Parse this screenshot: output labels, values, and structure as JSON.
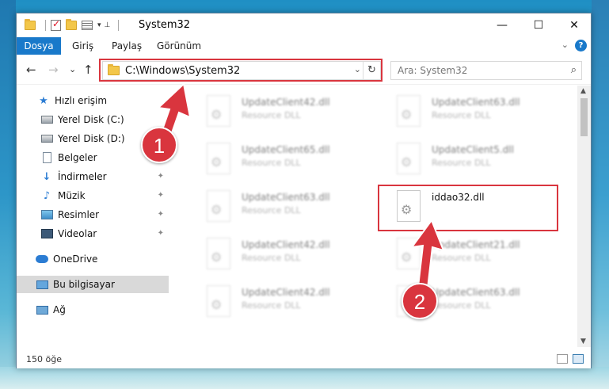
{
  "window": {
    "title": "System32",
    "minimize": "—",
    "maximize": "☐",
    "close": "✕"
  },
  "ribbon": {
    "tabs": [
      "Dosya",
      "Giriş",
      "Paylaş",
      "Görünüm"
    ],
    "expand_glyph": "⌄",
    "help_glyph": "?"
  },
  "nav": {
    "back": "←",
    "forward": "→",
    "recent": "⌄",
    "up": "↑",
    "address": "C:\\Windows\\System32",
    "dropdown": "⌄",
    "refresh": "↻",
    "search_placeholder": "Ara: System32",
    "search_icon": "⌕"
  },
  "sidebar": {
    "items": [
      {
        "label": "Hızlı erişim",
        "icon": "star-icon",
        "glyph": "★"
      },
      {
        "label": "Yerel Disk (C:)",
        "icon": "drive-icon"
      },
      {
        "label": "Yerel Disk (D:)",
        "icon": "drive-icon"
      },
      {
        "label": "Belgeler",
        "icon": "documents-icon"
      },
      {
        "label": "İndirmeler",
        "icon": "download-icon",
        "glyph": "↓"
      },
      {
        "label": "Müzik",
        "icon": "music-icon",
        "glyph": "♪"
      },
      {
        "label": "Resimler",
        "icon": "pictures-icon"
      },
      {
        "label": "Videolar",
        "icon": "videos-icon"
      },
      {
        "label": "OneDrive",
        "icon": "cloud-icon"
      },
      {
        "label": "Bu bilgisayar",
        "icon": "computer-icon"
      },
      {
        "label": "Ağ",
        "icon": "network-icon"
      }
    ],
    "pin_glyph": "📌"
  },
  "files": [
    {
      "name": "UpdateClient42.dll",
      "type": "Resource DLL"
    },
    {
      "name": "UpdateClient63.dll",
      "type": "Resource DLL"
    },
    {
      "name": "UpdateClient65.dll",
      "type": "Resource DLL"
    },
    {
      "name": "UpdateClient5.dll",
      "type": "Resource DLL"
    },
    {
      "name": "UpdateClient63.dll",
      "type": "Resource DLL"
    },
    {
      "name": "iddao32.dll",
      "type": ""
    },
    {
      "name": "UpdateClient42.dll",
      "type": "Resource DLL"
    },
    {
      "name": "UpdateClient21.dll",
      "type": "Resource DLL"
    },
    {
      "name": "UpdateClient42.dll",
      "type": "Resource DLL"
    },
    {
      "name": "UpdateClient63.dll",
      "type": "Resource DLL"
    }
  ],
  "status": {
    "count": "150 öğe"
  },
  "annotations": {
    "badge1": "1",
    "badge2": "2",
    "highlight_color": "#d9353e"
  },
  "scroll": {
    "up": "▲",
    "down": "▼"
  }
}
